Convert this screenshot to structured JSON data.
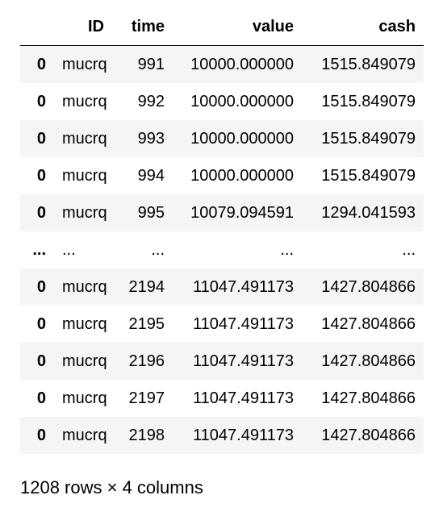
{
  "table": {
    "columns": {
      "index": "",
      "id": "ID",
      "time": "time",
      "value": "value",
      "cash": "cash"
    },
    "rows": [
      {
        "index": "0",
        "id": "mucrq",
        "time": "991",
        "value": "10000.000000",
        "cash": "1515.849079"
      },
      {
        "index": "0",
        "id": "mucrq",
        "time": "992",
        "value": "10000.000000",
        "cash": "1515.849079"
      },
      {
        "index": "0",
        "id": "mucrq",
        "time": "993",
        "value": "10000.000000",
        "cash": "1515.849079"
      },
      {
        "index": "0",
        "id": "mucrq",
        "time": "994",
        "value": "10000.000000",
        "cash": "1515.849079"
      },
      {
        "index": "0",
        "id": "mucrq",
        "time": "995",
        "value": "10079.094591",
        "cash": "1294.041593"
      },
      {
        "index": "...",
        "id": "...",
        "time": "...",
        "value": "...",
        "cash": "..."
      },
      {
        "index": "0",
        "id": "mucrq",
        "time": "2194",
        "value": "11047.491173",
        "cash": "1427.804866"
      },
      {
        "index": "0",
        "id": "mucrq",
        "time": "2195",
        "value": "11047.491173",
        "cash": "1427.804866"
      },
      {
        "index": "0",
        "id": "mucrq",
        "time": "2196",
        "value": "11047.491173",
        "cash": "1427.804866"
      },
      {
        "index": "0",
        "id": "mucrq",
        "time": "2197",
        "value": "11047.491173",
        "cash": "1427.804866"
      },
      {
        "index": "0",
        "id": "mucrq",
        "time": "2198",
        "value": "11047.491173",
        "cash": "1427.804866"
      }
    ]
  },
  "footer": {
    "shape_text": "1208 rows × 4 columns"
  }
}
